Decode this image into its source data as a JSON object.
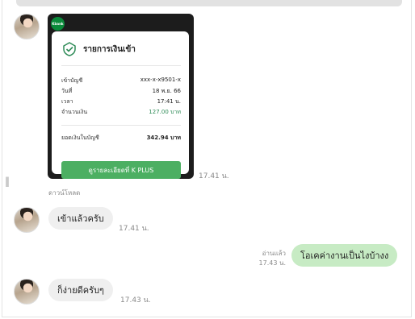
{
  "slip": {
    "logo_text": "Kbank",
    "title": "รายการเงินเข้า",
    "rows": [
      {
        "label": "เข้าบัญชี",
        "value": "xxx-x-x9501-x"
      },
      {
        "label": "วันที่",
        "value": "18 พ.ย. 66"
      },
      {
        "label": "เวลา",
        "value": "17:41 น."
      },
      {
        "label": "จำนวนเงิน",
        "value": "127.00 บาท"
      }
    ],
    "balance": {
      "label": "ยอดเงินในบัญชี",
      "value": "342.94 บาท"
    },
    "button_label": "ดูรายละเอียดที่ K PLUS",
    "time": "17.41 น."
  },
  "download_label": "ดาวน์โหลด",
  "messages": [
    {
      "text": "เข้าแล้วครับ",
      "time": "17.41 น."
    },
    {
      "text": "โอเคค่างานเป็นไงบ้างง",
      "time": "17.43 น.",
      "read": "อ่านแล้ว"
    },
    {
      "text": "ก็ง่ายดีครับๆ",
      "time": "17.43 น."
    }
  ],
  "colors": {
    "outgoing_bubble": "#c7ebc4",
    "incoming_bubble": "#efefef",
    "kplus_green": "#4caf62"
  }
}
